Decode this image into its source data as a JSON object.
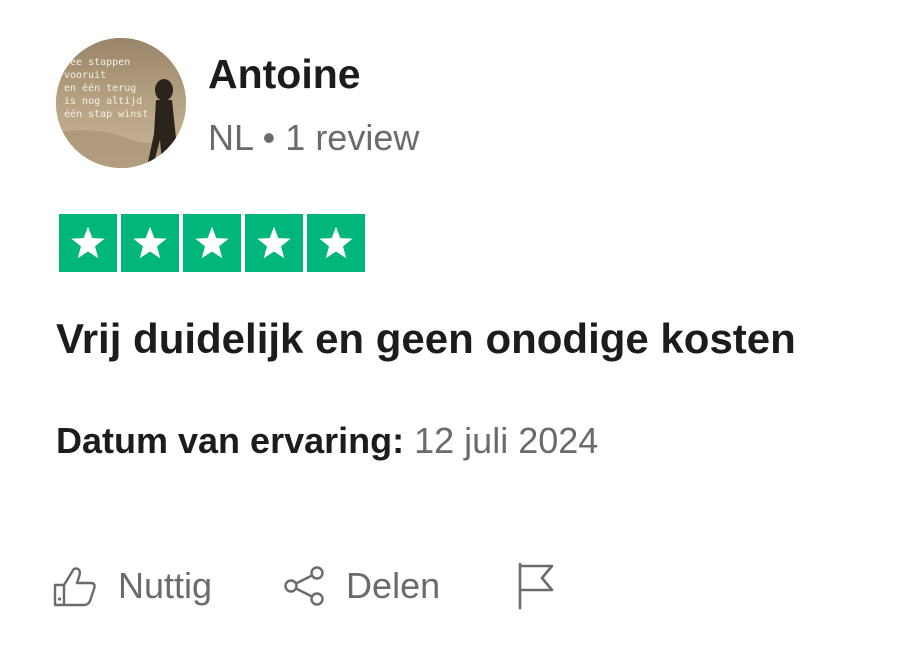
{
  "reviewer": {
    "name": "Antoine",
    "meta": "NL • 1 review",
    "avatar_text": "wee stappen\nvooruit\nen één terug\nis nog altijd\néén stap winst"
  },
  "rating": {
    "stars": 5,
    "max": 5,
    "color": "#00b67a"
  },
  "review": {
    "title": "Vrij duidelijk en geen onodige kosten",
    "date_label": "Datum van ervaring:",
    "date_value": "12 juli 2024"
  },
  "actions": {
    "helpful_label": "Nuttig",
    "share_label": "Delen",
    "icons": [
      "thumbs-up-icon",
      "share-icon",
      "flag-icon"
    ]
  },
  "colors": {
    "text": "#1c1c1c",
    "muted": "#6b6b6b",
    "star_bg": "#00b67a"
  }
}
